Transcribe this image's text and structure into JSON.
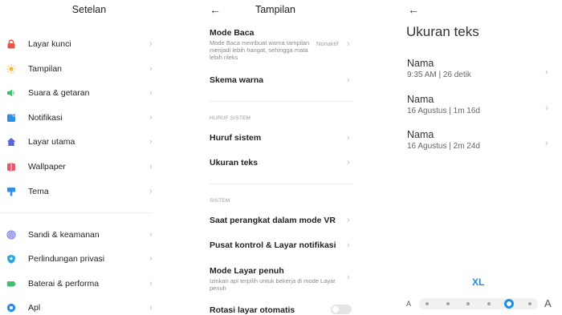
{
  "settings": {
    "title": "Setelan",
    "groups": [
      [
        {
          "label": "Layar kunci",
          "icon": "lock-icon",
          "color": "#e2554a"
        },
        {
          "label": "Tampilan",
          "icon": "sun-icon",
          "color": "#f2b630"
        },
        {
          "label": "Suara & getaran",
          "icon": "speaker-icon",
          "color": "#3fbf6a"
        },
        {
          "label": "Notifikasi",
          "icon": "notification-icon",
          "color": "#2f8fe6"
        },
        {
          "label": "Layar utama",
          "icon": "home-icon",
          "color": "#5a63e0"
        },
        {
          "label": "Wallpaper",
          "icon": "wallpaper-icon",
          "color": "#e4586f"
        },
        {
          "label": "Tema",
          "icon": "theme-brush-icon",
          "color": "#2f8fe6"
        }
      ],
      [
        {
          "label": "Sandi & keamanan",
          "icon": "fingerprint-icon",
          "color": "#6a6fe6"
        },
        {
          "label": "Perlindungan privasi",
          "icon": "privacy-shield-icon",
          "color": "#2fa6e0"
        },
        {
          "label": "Baterai & performa",
          "icon": "battery-icon",
          "color": "#3fbf6a"
        },
        {
          "label": "Apl",
          "icon": "apps-gear-icon",
          "color": "#2f8fe6"
        }
      ]
    ]
  },
  "tampilan": {
    "title": "Tampilan",
    "mode_baca": {
      "label": "Mode Baca",
      "desc": "Mode Baca membuat warna tampilan menjadi lebih hangat, sehingga mata lebih rileks",
      "value": "Nonaktif"
    },
    "skema_warna": "Skema warna",
    "section_huruf": "HURUF SISTEM",
    "huruf_sistem": "Huruf sistem",
    "ukuran_teks": "Ukuran teks",
    "section_sistem": "SISTEM",
    "vr_mode": "Saat perangkat dalam mode VR",
    "pusat_kontrol": "Pusat kontrol & Layar notifikasi",
    "layar_penuh": {
      "label": "Mode Layar penuh",
      "desc": "Izinkan apl terpilih untuk bekerja di mode Layar penuh"
    },
    "rotasi": {
      "label": "Rotasi layar otomatis",
      "enabled": false
    }
  },
  "ukuran": {
    "title": "Ukuran teks",
    "samples": [
      {
        "name": "Nama",
        "meta": "9:35 AM | 26 detik"
      },
      {
        "name": "Nama",
        "meta": "16 Agustus | 1m 16d"
      },
      {
        "name": "Nama",
        "meta": "16 Agustus | 2m 24d"
      }
    ],
    "current_size": "XL",
    "slider": {
      "min_label": "A",
      "max_label": "A",
      "steps": 5,
      "selected_index": 4
    },
    "accent_color": "#1a8fe3"
  }
}
